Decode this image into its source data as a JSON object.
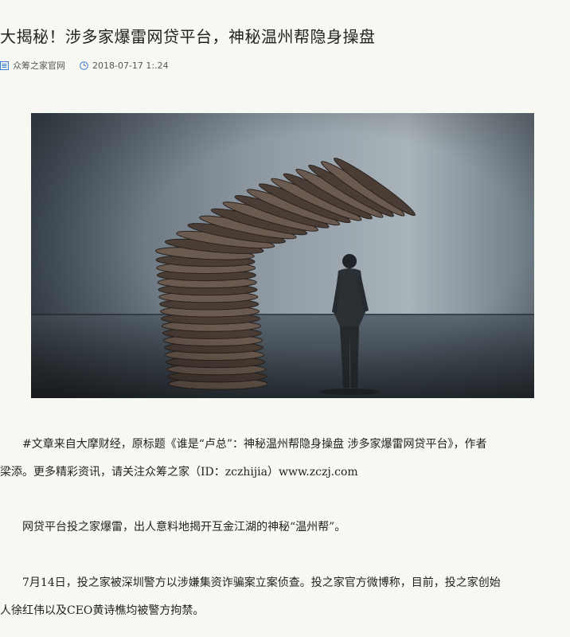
{
  "article": {
    "title": "大揭秘！涉多家爆雷网贷平台，神秘温州帮隐身操盘",
    "source": "众筹之家官网",
    "date": "2018-07-17 1:.24"
  },
  "icons": {
    "source": "document-icon",
    "date": "clock-icon",
    "accent": "#3a7bd5"
  },
  "image": {
    "subject": "falling-coin-stack-illustration"
  },
  "paragraphs": [
    {
      "line1": "　　#文章来自大摩财经，原标题《谁是“卢总”：神秘温州帮隐身操盘 涉多家爆雷网贷平台》，作者",
      "line2": "梁添。更多精彩资讯，请关注众筹之家（ID：zczhijia）www.zczj.com"
    },
    {
      "line1": "　　网贷平台投之家爆雷，出人意料地揭开互金江湖的神秘“温州帮”。"
    },
    {
      "line1": "　　7月14日，投之家被深圳警方以涉嫌集资诈骗案立案侦查。投之家官方微博称，目前，投之家创始",
      "line2": "人徐红伟以及CEO黄诗樵均被警方拘禁。"
    }
  ]
}
